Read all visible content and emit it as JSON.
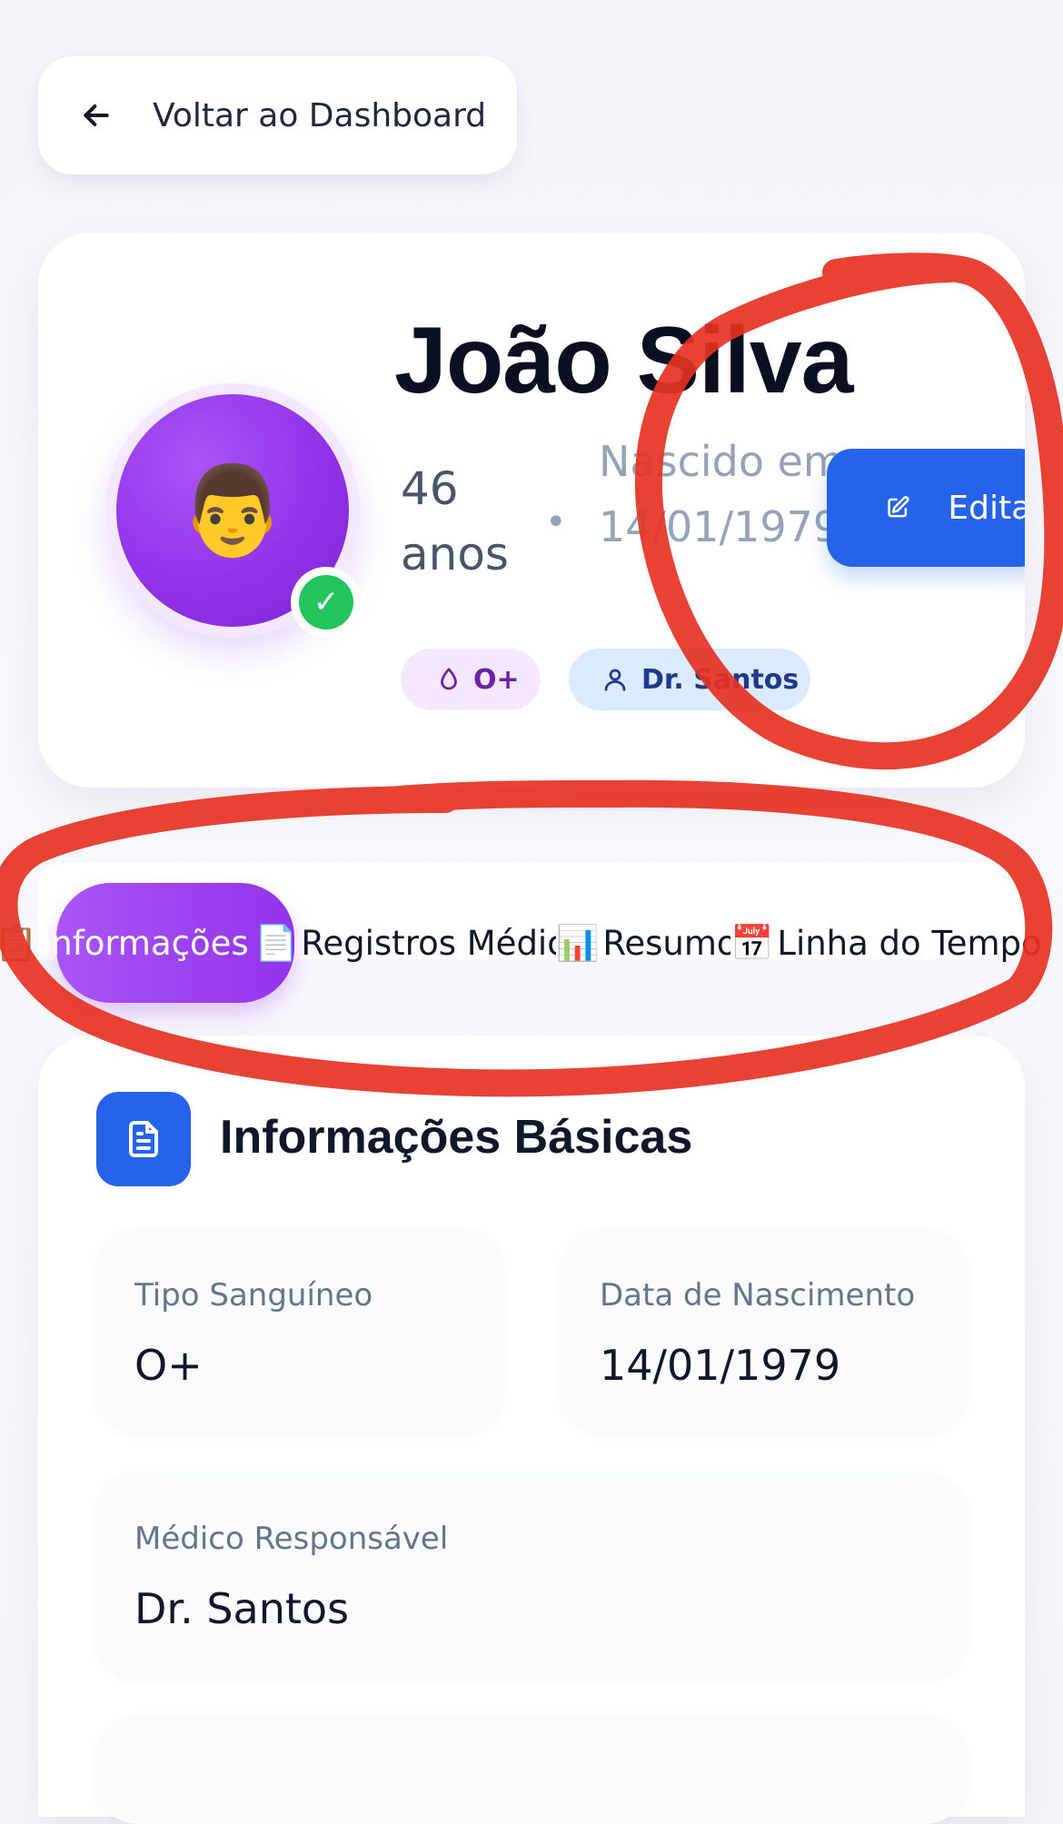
{
  "back": {
    "label": "Voltar ao Dashboard"
  },
  "patient": {
    "name": "João Silva",
    "avatar": "👨",
    "age": "46 anos",
    "separator": "•",
    "born": "Nascido em 14/01/1979",
    "blood_badge": "O+",
    "doctor_badge": "Dr. Santos"
  },
  "edit": {
    "label": "Editar"
  },
  "tabs": [
    {
      "icon": "📋",
      "label": "Informações Pessoais",
      "active": true
    },
    {
      "icon": "📄",
      "label": "Registros Médicos"
    },
    {
      "icon": "📊",
      "label": "Resumo"
    },
    {
      "icon": "📅",
      "label": "Linha do Tempo"
    }
  ],
  "basic_info": {
    "title": "Informações Básicas",
    "fields": [
      {
        "label": "Tipo Sanguíneo",
        "value": "O+"
      },
      {
        "label": "Data de Nascimento",
        "value": "14/01/1979"
      },
      {
        "label": "Médico Responsável",
        "value": "Dr. Santos"
      }
    ]
  },
  "colors": {
    "primary_blue": "#2563eb",
    "accent_purple": "#9333ea",
    "success_green": "#22c55e",
    "annotation_red": "#e53222"
  }
}
